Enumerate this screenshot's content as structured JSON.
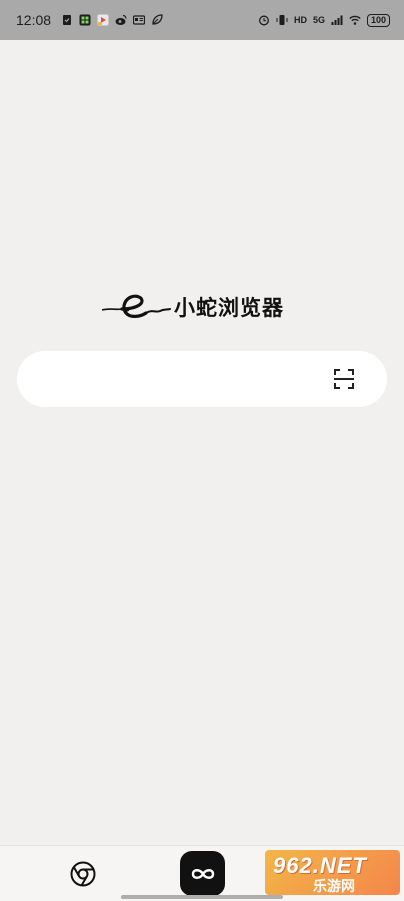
{
  "status_bar": {
    "time": "12:08",
    "network": "5G",
    "hd": "HD",
    "battery": "100",
    "left_icons": [
      "clipboard-icon",
      "app-grid-icon",
      "video-app-icon",
      "weibo-icon",
      "news-icon",
      "leaf-icon"
    ],
    "right_icons": [
      "alarm-icon",
      "vibrate-icon",
      "hd-icon",
      "signal-icon",
      "wifi-icon",
      "battery-icon"
    ]
  },
  "logo": {
    "text": "小蛇浏览器",
    "icon": "snake-logo-icon"
  },
  "search": {
    "placeholder": "",
    "value": "",
    "scan_icon": "scan-icon"
  },
  "bottom_bar": {
    "left_icon": "chrome-icon",
    "center_icon": "infinity-icon"
  },
  "watermark": {
    "top": "962.NET",
    "bottom": "乐游网"
  },
  "colors": {
    "background": "#f1f0ef",
    "status_bar": "#a9a9a9",
    "search_box": "#ffffff",
    "home_button": "#111111"
  }
}
